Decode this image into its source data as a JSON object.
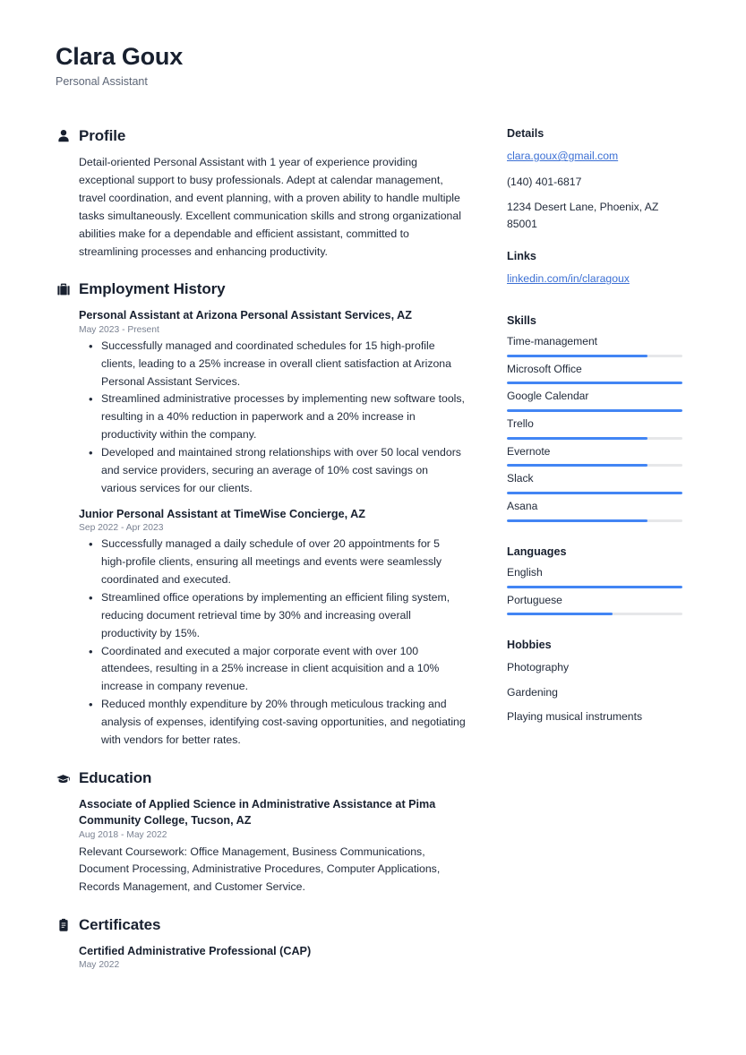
{
  "header": {
    "name": "Clara Goux",
    "title": "Personal Assistant"
  },
  "colors": {
    "accent": "#4285f4",
    "link": "#3b6fd4",
    "heading": "#18202f",
    "body": "#222b3b",
    "muted": "#7a8292",
    "track": "#e6e7e9",
    "background": "#ffffff"
  },
  "sections": {
    "profile": {
      "icon": "person-icon",
      "title": "Profile",
      "text": "Detail-oriented Personal Assistant with 1 year of experience providing exceptional support to busy professionals. Adept at calendar management, travel coordination, and event planning, with a proven ability to handle multiple tasks simultaneously. Excellent communication skills and strong organizational abilities make for a dependable and efficient assistant, committed to streamlining processes and enhancing productivity."
    },
    "employment": {
      "icon": "briefcase-icon",
      "title": "Employment History",
      "entries": [
        {
          "title": "Personal Assistant at Arizona Personal Assistant Services, AZ",
          "date": "May 2023 - Present",
          "bullets": [
            "Successfully managed and coordinated schedules for 15 high-profile clients, leading to a 25% increase in overall client satisfaction at Arizona Personal Assistant Services.",
            "Streamlined administrative processes by implementing new software tools, resulting in a 40% reduction in paperwork and a 20% increase in productivity within the company.",
            "Developed and maintained strong relationships with over 50 local vendors and service providers, securing an average of 10% cost savings on various services for our clients."
          ]
        },
        {
          "title": "Junior Personal Assistant at TimeWise Concierge, AZ",
          "date": "Sep 2022 - Apr 2023",
          "bullets": [
            "Successfully managed a daily schedule of over 20 appointments for 5 high-profile clients, ensuring all meetings and events were seamlessly coordinated and executed.",
            "Streamlined office operations by implementing an efficient filing system, reducing document retrieval time by 30% and increasing overall productivity by 15%.",
            "Coordinated and executed a major corporate event with over 100 attendees, resulting in a 25% increase in client acquisition and a 10% increase in company revenue.",
            "Reduced monthly expenditure by 20% through meticulous tracking and analysis of expenses, identifying cost-saving opportunities, and negotiating with vendors for better rates."
          ]
        }
      ]
    },
    "education": {
      "icon": "graduation-cap-icon",
      "title": "Education",
      "entries": [
        {
          "title": "Associate of Applied Science in Administrative Assistance at Pima Community College, Tucson, AZ",
          "date": "Aug 2018 - May 2022",
          "description": "Relevant Coursework: Office Management, Business Communications, Document Processing, Administrative Procedures, Computer Applications, Records Management, and Customer Service."
        }
      ]
    },
    "certificates": {
      "icon": "clipboard-icon",
      "title": "Certificates",
      "entries": [
        {
          "title": "Certified Administrative Professional (CAP)",
          "date": "May 2022"
        }
      ]
    }
  },
  "sidebar": {
    "details": {
      "title": "Details",
      "email": "clara.goux@gmail.com",
      "phone": "(140) 401-6817",
      "address": "1234 Desert Lane, Phoenix, AZ 85001"
    },
    "links": {
      "title": "Links",
      "items": [
        {
          "label": "linkedin.com/in/claragoux"
        }
      ]
    },
    "skills": {
      "title": "Skills",
      "items": [
        {
          "label": "Time-management",
          "level": 80
        },
        {
          "label": "Microsoft Office",
          "level": 100
        },
        {
          "label": "Google Calendar",
          "level": 100
        },
        {
          "label": "Trello",
          "level": 80
        },
        {
          "label": "Evernote",
          "level": 80
        },
        {
          "label": "Slack",
          "level": 100
        },
        {
          "label": "Asana",
          "level": 80
        }
      ]
    },
    "languages": {
      "title": "Languages",
      "items": [
        {
          "label": "English",
          "level": 100
        },
        {
          "label": "Portuguese",
          "level": 60
        }
      ]
    },
    "hobbies": {
      "title": "Hobbies",
      "items": [
        {
          "label": "Photography"
        },
        {
          "label": "Gardening"
        },
        {
          "label": "Playing musical instruments"
        }
      ]
    }
  }
}
